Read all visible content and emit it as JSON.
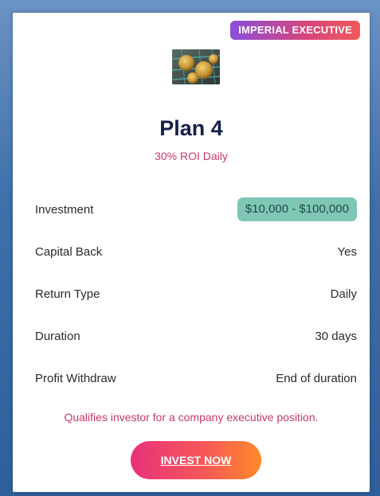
{
  "badge": "IMPERIAL EXECUTIVE",
  "image": {
    "icon": "bitcoin-coins-image"
  },
  "plan": {
    "title": "Plan 4",
    "roi": "30% ROI Daily"
  },
  "details": [
    {
      "label": "Investment",
      "value": "$10,000 - $100,000"
    },
    {
      "label": "Capital Back",
      "value": "Yes"
    },
    {
      "label": "Return Type",
      "value": "Daily"
    },
    {
      "label": "Duration",
      "value": "30 days"
    },
    {
      "label": "Profit Withdraw",
      "value": "End of duration"
    }
  ],
  "note": "Qualifies investor for a company executive position.",
  "cta": {
    "label": "INVEST NOW"
  },
  "colors": {
    "accent": "#c8386f",
    "title": "#14204a",
    "pill": "#7fc6b5",
    "badge_start": "#8a4fd9",
    "badge_end": "#f05a5a",
    "button_start": "#e8327a",
    "button_end": "#ff8a2a"
  }
}
